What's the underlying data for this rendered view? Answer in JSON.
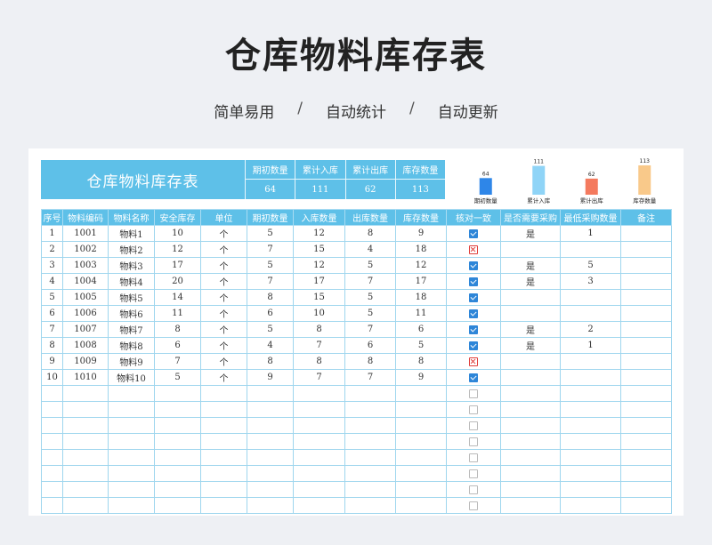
{
  "page": {
    "title": "仓库物料库存表",
    "subtitle": [
      "简单易用",
      "自动统计",
      "自动更新"
    ],
    "separator": "/"
  },
  "summary": {
    "title": "仓库物料库存表",
    "boxes": [
      {
        "label": "期初数量",
        "value": "64"
      },
      {
        "label": "累计入库",
        "value": "111"
      },
      {
        "label": "累计出库",
        "value": "62"
      },
      {
        "label": "库存数量",
        "value": "113"
      }
    ]
  },
  "chart_data": {
    "type": "bar",
    "categories": [
      "期初数量",
      "累计入库",
      "累计出库",
      "库存数量"
    ],
    "values": [
      64,
      111,
      62,
      113
    ],
    "colors": [
      "#2e86e8",
      "#8fd4f7",
      "#f47a5e",
      "#f9c98a"
    ],
    "title": "",
    "xlabel": "",
    "ylabel": ""
  },
  "table": {
    "headers": [
      "序号",
      "物料编码",
      "物料名称",
      "安全库存",
      "单位",
      "期初数量",
      "入库数量",
      "出库数量",
      "库存数量",
      "核对一致",
      "是否需要采购",
      "最低采购数量",
      "备注"
    ],
    "rows": [
      {
        "cells": [
          "1",
          "1001",
          "物料1",
          "10",
          "个",
          "5",
          "12",
          "8",
          "9"
        ],
        "check": "ok",
        "need": "是",
        "min": "1",
        "note": ""
      },
      {
        "cells": [
          "2",
          "1002",
          "物料2",
          "12",
          "个",
          "7",
          "15",
          "4",
          "18"
        ],
        "check": "bad",
        "need": "",
        "min": "",
        "note": ""
      },
      {
        "cells": [
          "3",
          "1003",
          "物料3",
          "17",
          "个",
          "5",
          "12",
          "5",
          "12"
        ],
        "check": "ok",
        "need": "是",
        "min": "5",
        "note": ""
      },
      {
        "cells": [
          "4",
          "1004",
          "物料4",
          "20",
          "个",
          "7",
          "17",
          "7",
          "17"
        ],
        "check": "ok",
        "need": "是",
        "min": "3",
        "note": ""
      },
      {
        "cells": [
          "5",
          "1005",
          "物料5",
          "14",
          "个",
          "8",
          "15",
          "5",
          "18"
        ],
        "check": "ok",
        "need": "",
        "min": "",
        "note": ""
      },
      {
        "cells": [
          "6",
          "1006",
          "物料6",
          "11",
          "个",
          "6",
          "10",
          "5",
          "11"
        ],
        "check": "ok",
        "need": "",
        "min": "",
        "note": ""
      },
      {
        "cells": [
          "7",
          "1007",
          "物料7",
          "8",
          "个",
          "5",
          "8",
          "7",
          "6"
        ],
        "check": "ok",
        "need": "是",
        "min": "2",
        "note": ""
      },
      {
        "cells": [
          "8",
          "1008",
          "物料8",
          "6",
          "个",
          "4",
          "7",
          "6",
          "5"
        ],
        "check": "ok",
        "need": "是",
        "min": "1",
        "note": ""
      },
      {
        "cells": [
          "9",
          "1009",
          "物料9",
          "7",
          "个",
          "8",
          "8",
          "8",
          "8"
        ],
        "check": "bad",
        "need": "",
        "min": "",
        "note": ""
      },
      {
        "cells": [
          "10",
          "1010",
          "物料10",
          "5",
          "个",
          "9",
          "7",
          "7",
          "9"
        ],
        "check": "ok",
        "need": "",
        "min": "",
        "note": ""
      },
      {
        "cells": [
          "",
          "",
          "",
          "",
          "",
          "",
          "",
          "",
          ""
        ],
        "check": "empty",
        "need": "",
        "min": "",
        "note": ""
      },
      {
        "cells": [
          "",
          "",
          "",
          "",
          "",
          "",
          "",
          "",
          ""
        ],
        "check": "empty",
        "need": "",
        "min": "",
        "note": ""
      },
      {
        "cells": [
          "",
          "",
          "",
          "",
          "",
          "",
          "",
          "",
          ""
        ],
        "check": "empty",
        "need": "",
        "min": "",
        "note": ""
      },
      {
        "cells": [
          "",
          "",
          "",
          "",
          "",
          "",
          "",
          "",
          ""
        ],
        "check": "empty",
        "need": "",
        "min": "",
        "note": ""
      },
      {
        "cells": [
          "",
          "",
          "",
          "",
          "",
          "",
          "",
          "",
          ""
        ],
        "check": "empty",
        "need": "",
        "min": "",
        "note": ""
      },
      {
        "cells": [
          "",
          "",
          "",
          "",
          "",
          "",
          "",
          "",
          ""
        ],
        "check": "empty",
        "need": "",
        "min": "",
        "note": ""
      },
      {
        "cells": [
          "",
          "",
          "",
          "",
          "",
          "",
          "",
          "",
          ""
        ],
        "check": "empty",
        "need": "",
        "min": "",
        "note": ""
      },
      {
        "cells": [
          "",
          "",
          "",
          "",
          "",
          "",
          "",
          "",
          ""
        ],
        "check": "empty",
        "need": "",
        "min": "",
        "note": ""
      }
    ]
  }
}
